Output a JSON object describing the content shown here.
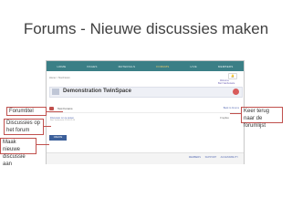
{
  "slide": {
    "title": "Forums - Nieuwe discussies maken"
  },
  "nav": {
    "items": [
      "HOME",
      "PAGES",
      "MATERIALS",
      "FORUMS",
      "LIVE",
      "MEMBERS"
    ],
    "active_index": 3
  },
  "header": {
    "breadcrumb": "Home > Test Forum",
    "space_name": "Demonstration TwinSpace",
    "user_label": "Welcome",
    "user_name": "Bert Vanbutsele",
    "bell_icon": "bell-icon"
  },
  "forum": {
    "title": "Test Forums",
    "back_link": "Back to forums",
    "discussion_link": "Discussie om te testen",
    "discussion_meta": "Bert Vanbutsele 2014-02-14",
    "discussion_count": "0 replies",
    "new_button": "CREATE THREAD",
    "footer_links": "MEMBERS   SUPPORT   ACCESSIBILITY"
  },
  "callouts": {
    "forum_title": "Forumtitel",
    "discussions": "Discussies op het forum",
    "create_new": "Maak nieuwe discussie aan",
    "back": "Keer terug naar de forumlijst"
  },
  "colors": {
    "nav": "#3b7f86",
    "accent": "#c0504d",
    "link": "#5b6fb5"
  }
}
